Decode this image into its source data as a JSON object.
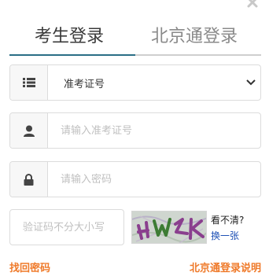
{
  "close": {
    "icon": "close-icon"
  },
  "tabs": {
    "active_label": "考生登录",
    "inactive_label": "北京通登录"
  },
  "fields": {
    "id_type": {
      "value": "准考证号",
      "options": [
        "准考证号"
      ],
      "icon": "list-icon"
    },
    "username": {
      "placeholder": "请输入准考证号",
      "icon": "user-icon"
    },
    "password": {
      "placeholder": "请输入密码",
      "icon": "lock-icon"
    }
  },
  "captcha": {
    "placeholder": "验证码不分大小写",
    "unclear_label": "看不清?",
    "refresh_label": "换一张"
  },
  "links": {
    "forgot_password": "找回密码",
    "beijingtong_help": "北京通登录说明"
  },
  "colors": {
    "accent_tab": "#2a6e86",
    "link_orange": "#ef7a2a",
    "link_blue": "#1c4fb5"
  }
}
